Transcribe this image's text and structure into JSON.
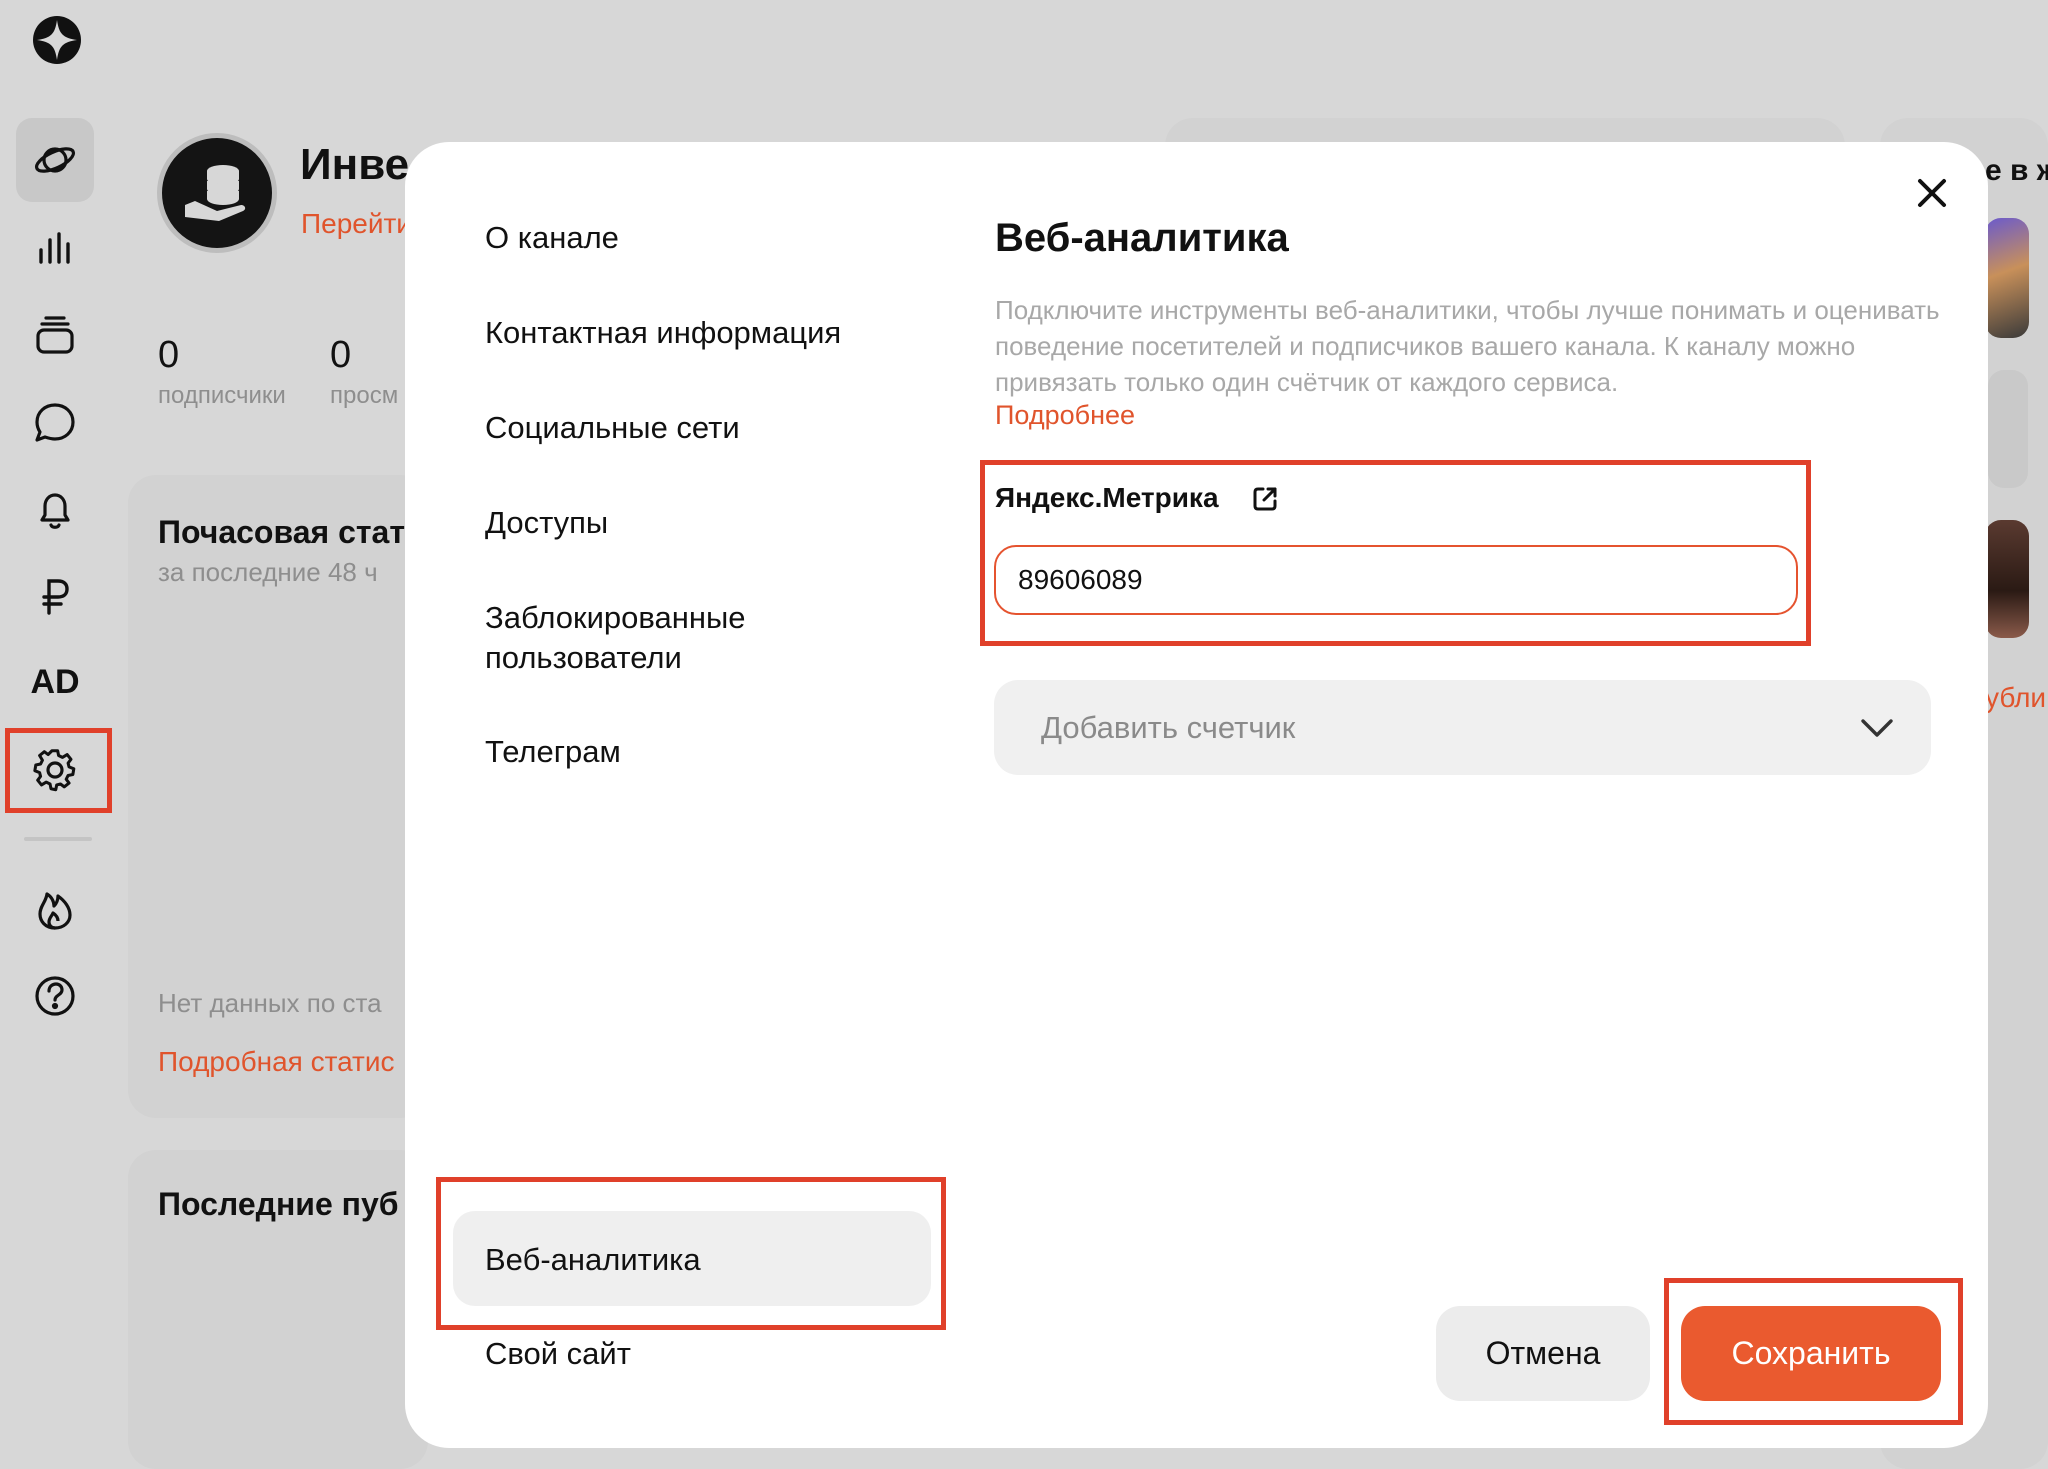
{
  "app": {
    "nav": {
      "ad_label": "AD"
    },
    "channel": {
      "name": "Инве",
      "link": "Перейти",
      "stats": [
        {
          "value": "0",
          "label": "подписчики"
        },
        {
          "value": "0",
          "label": "просм"
        }
      ]
    },
    "hourly_card": {
      "title": "Почасовая стат",
      "subtitle": "за последние 48 ч",
      "empty_text": "Нет данных по ста",
      "link": "Подробная статис"
    },
    "latest_card": {
      "title": "Последние пуб"
    },
    "right_panel": {
      "title": "е в ж",
      "link": "убли"
    }
  },
  "modal": {
    "menu": [
      "О канале",
      "Контактная информация",
      "Социальные сети",
      "Доступы",
      "Заблокированные пользователи",
      "Телеграм",
      "Веб-аналитика",
      "Свой сайт"
    ],
    "active_menu": "Веб-аналитика",
    "title": "Веб-аналитика",
    "description": "Подключите инструменты веб-аналитики, чтобы лучше понимать и оценивать поведение посетителей и подписчиков вашего канала. К каналу можно привязать только один счётчик от каждого сервиса.",
    "more_link": "Подробнее",
    "metrika": {
      "label": "Яндекс.Метрика",
      "value": "89606089"
    },
    "add_counter_label": "Добавить счетчик",
    "cancel_label": "Отмена",
    "save_label": "Сохранить"
  },
  "colors": {
    "accent": "#ea5a2f",
    "highlight": "#e0402a",
    "backdrop": "#d7d7d7"
  }
}
